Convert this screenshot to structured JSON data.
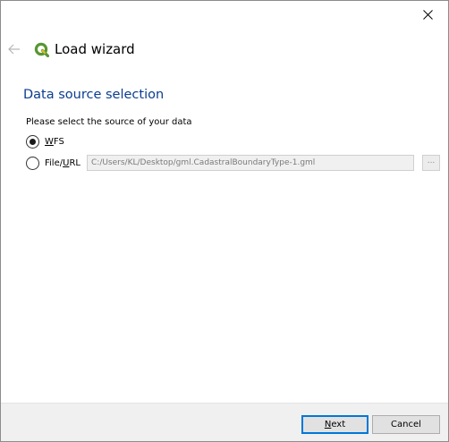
{
  "window": {
    "close_icon": "close-icon"
  },
  "header": {
    "back_icon": "back-arrow-icon",
    "logo_icon": "qgis-logo-icon",
    "title": "Load wizard"
  },
  "page": {
    "section_title": "Data source selection",
    "prompt": "Please select the source of your data",
    "options": [
      {
        "mnemonic": "W",
        "rest": "FS",
        "selected": true
      },
      {
        "prefix": "File/",
        "mnemonic": "U",
        "rest": "RL",
        "selected": false
      }
    ],
    "path_value": "C:/Users/KL/Desktop/gml.CadastralBoundaryType-1.gml",
    "browse_label": "..."
  },
  "footer": {
    "next": {
      "mnemonic": "N",
      "rest": "ext"
    },
    "cancel_label": "Cancel"
  },
  "colors": {
    "section_title": "#0a3d91",
    "logo_green": "#589632",
    "logo_yellow": "#eebc20",
    "default_button_border": "#0078d7"
  }
}
